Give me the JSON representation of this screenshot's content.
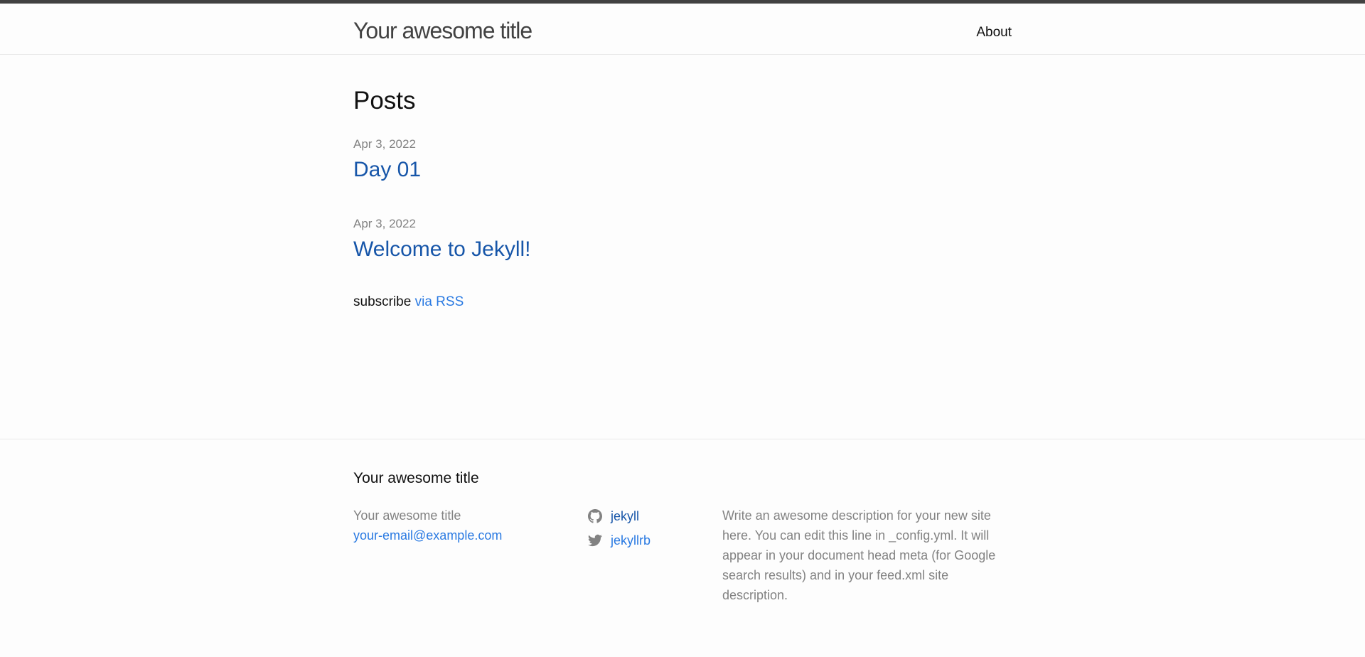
{
  "header": {
    "site_title": "Your awesome title",
    "nav_about": "About"
  },
  "main": {
    "heading": "Posts",
    "posts": [
      {
        "date": "Apr 3, 2022",
        "title": "Day 01"
      },
      {
        "date": "Apr 3, 2022",
        "title": "Welcome to Jekyll!"
      }
    ],
    "rss_prefix": "subscribe",
    "rss_link": "via RSS"
  },
  "footer": {
    "heading": "Your awesome title",
    "title_line": "Your awesome title",
    "email": "your-email@example.com",
    "social": {
      "github": "jekyll",
      "twitter": "jekyllrb"
    },
    "description": "Write an awesome description for your new site here. You can edit this line in _config.yml. It will appear in your document head meta (for Google search results) and in your feed.xml site description."
  },
  "icons": {
    "github": "github-icon",
    "twitter": "twitter-icon"
  },
  "colors": {
    "link": "#2a7ae2",
    "visited": "#1756a9",
    "muted": "#828282",
    "topbar": "#424242"
  }
}
